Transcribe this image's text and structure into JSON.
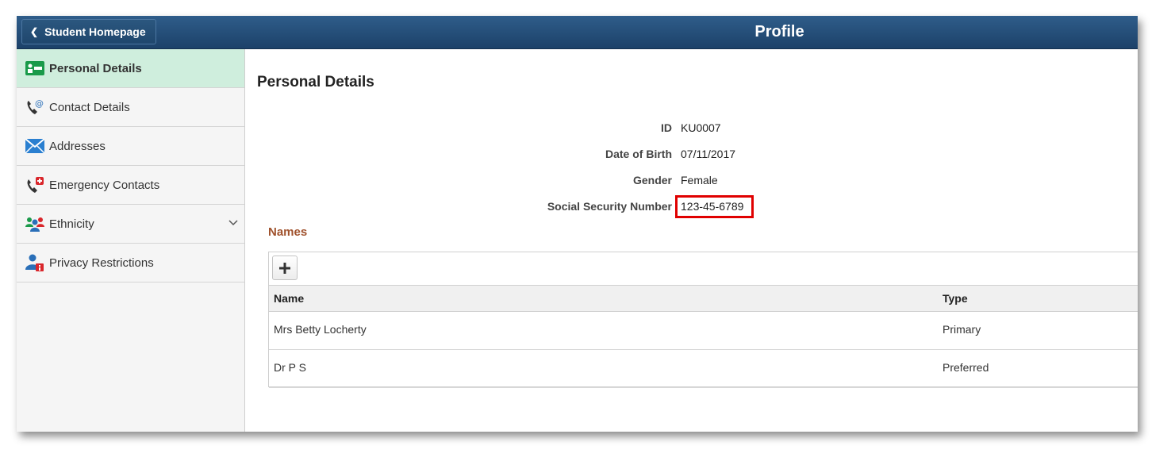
{
  "header": {
    "back_label": "Student Homepage",
    "title": "Profile"
  },
  "sidebar": {
    "items": [
      {
        "label": "Personal Details",
        "icon": "id-card-icon"
      },
      {
        "label": "Contact Details",
        "icon": "phone-at-icon"
      },
      {
        "label": "Addresses",
        "icon": "envelope-icon"
      },
      {
        "label": "Emergency Contacts",
        "icon": "phone-emergency-icon"
      },
      {
        "label": "Ethnicity",
        "icon": "group-people-icon"
      },
      {
        "label": "Privacy Restrictions",
        "icon": "person-lock-icon"
      }
    ]
  },
  "main": {
    "section_title": "Personal Details",
    "fields": [
      {
        "label": "ID",
        "value": "KU0007"
      },
      {
        "label": "Date of Birth",
        "value": "07/11/2017"
      },
      {
        "label": "Gender",
        "value": "Female"
      },
      {
        "label": "Social Security Number",
        "value": "123-45-6789"
      }
    ],
    "names": {
      "title": "Names",
      "columns": [
        "Name",
        "Type"
      ],
      "rows": [
        {
          "name": "Mrs Betty Locherty",
          "type": "Primary"
        },
        {
          "name": "Dr P S",
          "type": "Preferred"
        }
      ]
    }
  },
  "colors": {
    "header_bg": "#1c4169",
    "active_nav": "#cfeedd",
    "names_title": "#a0522d",
    "highlight_box": "#e00000"
  }
}
